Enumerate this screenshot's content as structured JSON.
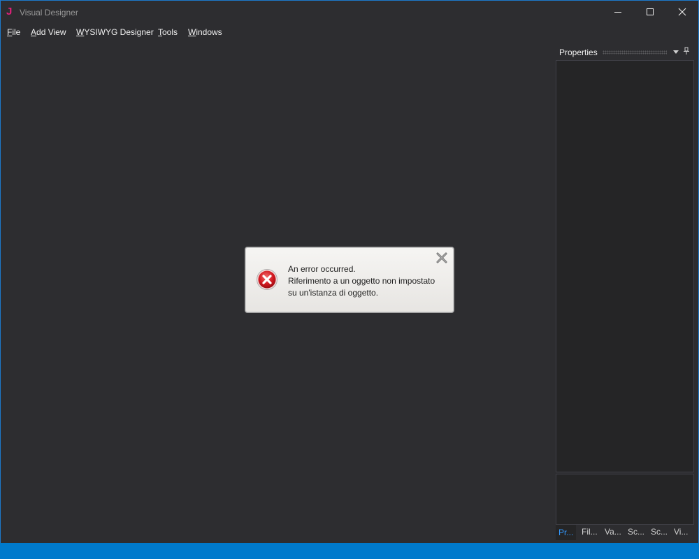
{
  "window": {
    "title": "Visual Designer",
    "logo_letter": "J",
    "accent_color": "#007acc",
    "logo_color": "#e0207a"
  },
  "menu": {
    "file": {
      "accel": "F",
      "rest": "ile"
    },
    "add_view": {
      "accel": "A",
      "rest": "dd View"
    },
    "wysiwyg": {
      "accel": "W",
      "rest": "YSIWYG Designer"
    },
    "tools": {
      "accel": "T",
      "rest": "ools"
    },
    "windows": {
      "accel": "W",
      "rest": "indows"
    }
  },
  "properties": {
    "title": "Properties",
    "tabs": [
      "Pr...",
      "Fil...",
      "Va...",
      "Sc...",
      "Sc...",
      "Vi..."
    ],
    "active_tab_color": "#3399ff"
  },
  "toast": {
    "line1": "An error occurred.",
    "line2": "Riferimento a un oggetto non impostato",
    "line3": "su un'istanza di oggetto.",
    "icon": "error-icon",
    "close_icon": "close-icon"
  },
  "icons": {
    "minimize": "minimize-icon",
    "maximize": "maximize-icon",
    "close": "close-icon",
    "dropdown": "chevron-down-icon",
    "pin": "pin-icon"
  }
}
